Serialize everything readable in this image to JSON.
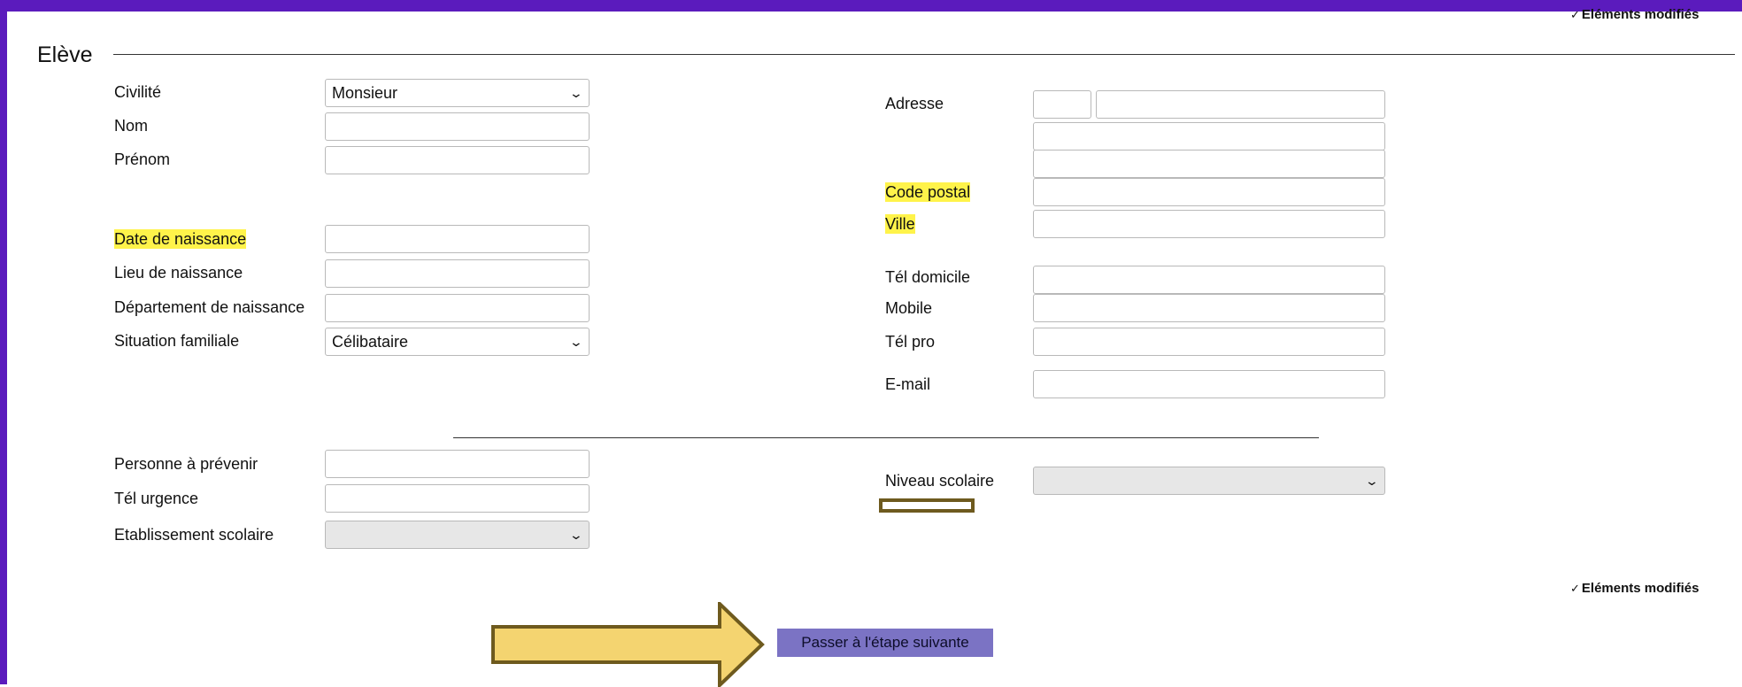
{
  "header": {
    "modified_note_top": "Eléments modifiés",
    "modified_note_bottom": "Eléments modifiés",
    "check_icon": "✓"
  },
  "section": {
    "title": "Elève"
  },
  "left": {
    "civilite": {
      "label": "Civilité",
      "value": "Monsieur"
    },
    "nom": {
      "label": "Nom",
      "value": ""
    },
    "prenom": {
      "label": "Prénom",
      "value": ""
    },
    "date_naissance": {
      "label": "Date de naissance",
      "value": ""
    },
    "lieu_naissance": {
      "label": "Lieu de naissance",
      "value": ""
    },
    "dept_naissance": {
      "label": "Département de naissance",
      "value": ""
    },
    "situation": {
      "label": "Situation familiale",
      "value": "Célibataire"
    }
  },
  "right": {
    "adresse": {
      "label": "Adresse"
    },
    "code_postal": {
      "label": "Code postal",
      "value": ""
    },
    "ville": {
      "label": "Ville",
      "value": ""
    },
    "tel_domicile": {
      "label": "Tél domicile",
      "value": ""
    },
    "mobile": {
      "label": "Mobile",
      "value": ""
    },
    "tel_pro": {
      "label": "Tél pro",
      "value": ""
    },
    "email": {
      "label": "E-mail",
      "value": ""
    }
  },
  "bottom": {
    "personne_prevenir": {
      "label": "Personne à prévenir",
      "value": ""
    },
    "tel_urgence": {
      "label": "Tél urgence",
      "value": ""
    },
    "etablissement": {
      "label": "Etablissement scolaire",
      "value": ""
    },
    "niveau": {
      "label": "Niveau scolaire",
      "value": ""
    }
  },
  "actions": {
    "next_label": "Passer à l'étape suivante"
  },
  "icons": {
    "dropdown": "chevron-down-icon",
    "pointer": "arrow-right-icon"
  },
  "colors": {
    "frame": "#5b1bbd",
    "highlight": "#fff34a",
    "button": "#7b73c4",
    "arrow_fill": "#f4d470",
    "arrow_border": "#6e5a1e"
  }
}
